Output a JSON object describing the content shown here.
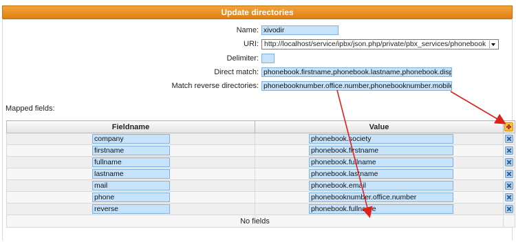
{
  "header": {
    "title": "Update directories"
  },
  "form": {
    "name": {
      "label": "Name:",
      "value": "xivodir"
    },
    "uri": {
      "label": "URI:",
      "value": "http://localhost/service/ipbx/json.php/private/pbx_services/phonebook"
    },
    "delimiter": {
      "label": "Delimiter:",
      "value": ""
    },
    "direct_match": {
      "label": "Direct match:",
      "value": "phonebook.firstname,phonebook.lastname,phonebook.displayname"
    },
    "match_reverse": {
      "label": "Match reverse directories:",
      "value": "phonebooknumber.office.number,phonebooknumber.mobile.number"
    }
  },
  "mapped": {
    "label": "Mapped fields:",
    "columns": {
      "fieldname": "Fieldname",
      "value": "Value"
    },
    "rows": [
      {
        "fieldname": "company",
        "value": "phonebook.society"
      },
      {
        "fieldname": "firstname",
        "value": "phonebook.firstname"
      },
      {
        "fieldname": "fullname",
        "value": "phonebook.fullname"
      },
      {
        "fieldname": "lastname",
        "value": "phonebook.lastname"
      },
      {
        "fieldname": "mail",
        "value": "phonebook.email"
      },
      {
        "fieldname": "phone",
        "value": "phonebooknumber.office.number"
      },
      {
        "fieldname": "reverse",
        "value": "phonebook.fullname"
      }
    ],
    "empty_text": "No fields"
  },
  "icons": {
    "add": "add-icon",
    "delete": "delete-icon"
  },
  "colors": {
    "header": "#e8901f",
    "input_bg": "#c7e3fb",
    "annotation_arrow": "#e0201b"
  }
}
